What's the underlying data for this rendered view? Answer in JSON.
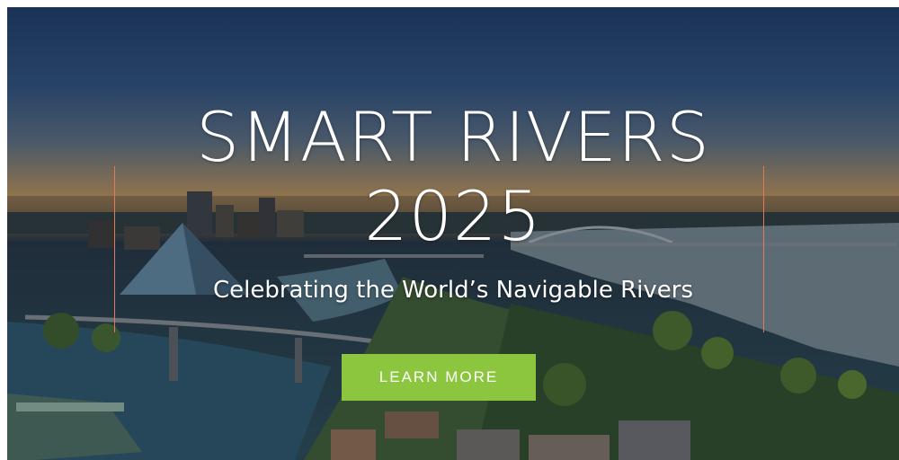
{
  "hero": {
    "title_line1": "SMART RIVERS",
    "title_line2": "2025",
    "subtitle": "Celebrating the World’s Navigable Rivers",
    "cta_label": "LEARN MORE",
    "accent_color": "#8cc63f",
    "rule_color": "#e27a5a"
  }
}
